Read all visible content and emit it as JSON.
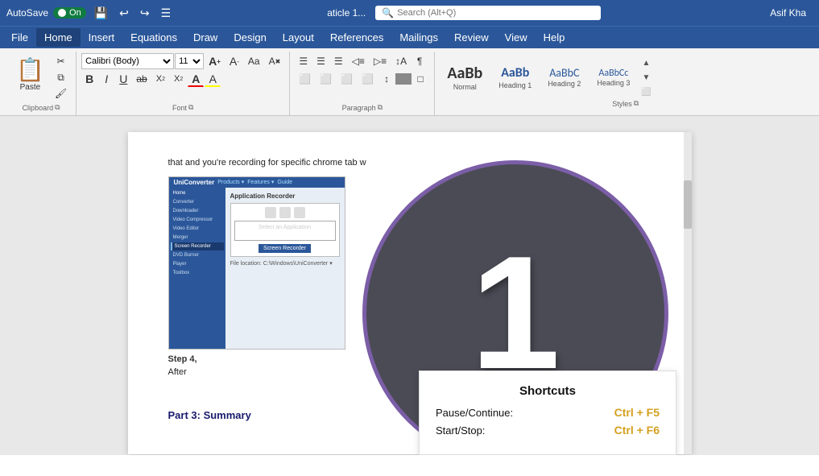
{
  "titlebar": {
    "autosave_label": "AutoSave",
    "autosave_state": "On",
    "save_icon": "💾",
    "undo_icon": "↩",
    "redo_icon": "↪",
    "menu_icon": "☰",
    "filename": "aticle 1...",
    "search_placeholder": "Search (Alt+Q)",
    "user": "Asif Kha"
  },
  "menubar": {
    "items": [
      "File",
      "Home",
      "Insert",
      "Equations",
      "Draw",
      "Design",
      "Layout",
      "References",
      "Mailings",
      "Review",
      "View",
      "Help"
    ]
  },
  "ribbon": {
    "clipboard": {
      "paste_label": "Paste",
      "cut_label": "Cut",
      "copy_label": "Copy",
      "format_painter_label": "Format Painter",
      "group_label": "Clipboard"
    },
    "font": {
      "font_name": "Calibri (Body)",
      "font_size": "11",
      "grow_icon": "A↑",
      "shrink_icon": "A↓",
      "change_case_icon": "Aa",
      "clear_format_icon": "A",
      "bold": "B",
      "italic": "I",
      "underline": "U",
      "strikethrough": "ab",
      "subscript": "X₂",
      "superscript": "X²",
      "font_color": "A",
      "highlight": "A",
      "group_label": "Font"
    },
    "paragraph": {
      "bullets_icon": "≡",
      "numbering_icon": "≡",
      "multilevel_icon": "≡",
      "decrease_indent": "←≡",
      "increase_indent": "→≡",
      "sort_icon": "↕A",
      "show_formatting": "¶",
      "align_left": "≡",
      "align_center": "≡",
      "align_right": "≡",
      "justify": "≡",
      "line_spacing": "≡",
      "shading": "■",
      "borders": "□",
      "group_label": "Paragraph"
    },
    "styles": {
      "normal_text": "AaBb",
      "normal_label": "Normal",
      "h1_text": "AaBbC",
      "h1_label": "Heading 1",
      "h2_text": "AaBbCcI",
      "h2_label": "Heading 2",
      "h3_text": "AaBbCcI",
      "h3_label": "Heading 3",
      "group_label": "Styles"
    }
  },
  "doc": {
    "text1": "that and you're recording for specific chrome tab w",
    "step4": "Step 4,",
    "after": "After",
    "part3": "Part 3: Summary"
  },
  "embedded": {
    "app_name": "UniConverter",
    "nav_items": [
      "Home",
      "Converter",
      "Downloader",
      "Video Compressor",
      "Video Editor",
      "Merger",
      "Screen Recorder",
      "DVD Burner",
      "Player",
      "Toolbox"
    ],
    "app_recorder": "Application Recorder",
    "select_app": "Select an Application",
    "screen_recorder": "Screen Recorder"
  },
  "circle": {
    "number": "1"
  },
  "shortcuts": {
    "title": "Shortcuts",
    "pause_label": "Pause/Continue:",
    "pause_key": "Ctrl + F5",
    "start_label": "Start/Stop:",
    "start_key": "Ctrl + F6"
  }
}
